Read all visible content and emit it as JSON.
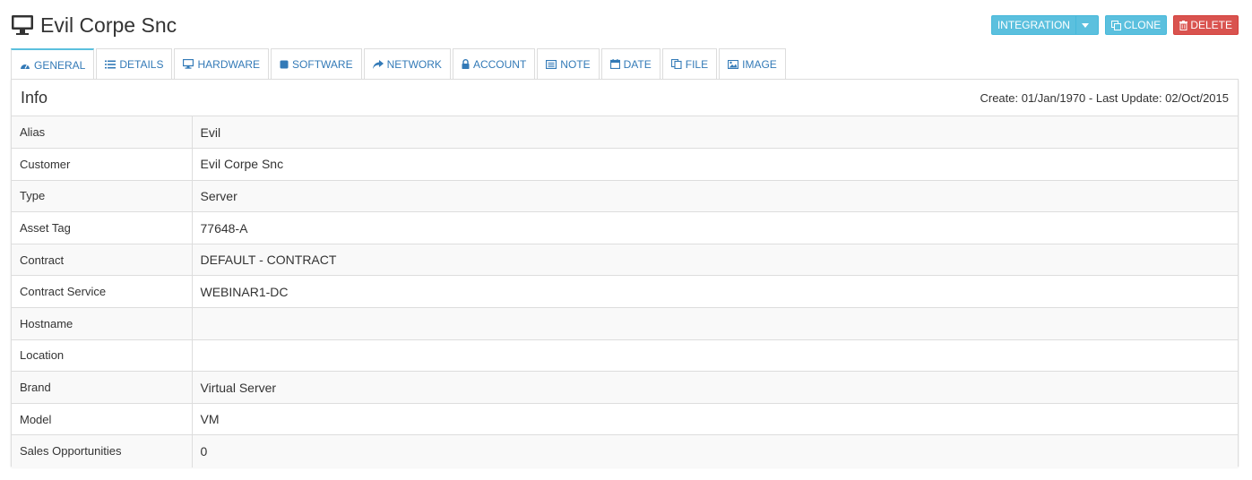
{
  "header": {
    "title": "Evil Corpe Snc",
    "icon": "monitor-icon"
  },
  "actions": {
    "integration": "INTEGRATION",
    "clone": "CLONE",
    "delete": "DELETE"
  },
  "tabs": [
    {
      "label": "GENERAL",
      "icon": "dashboard-icon"
    },
    {
      "label": "DETAILS",
      "icon": "list-icon"
    },
    {
      "label": "HARDWARE",
      "icon": "monitor-icon"
    },
    {
      "label": "SOFTWARE",
      "icon": "square-icon"
    },
    {
      "label": "NETWORK",
      "icon": "share-icon"
    },
    {
      "label": "ACCOUNT",
      "icon": "lock-icon"
    },
    {
      "label": "NOTE",
      "icon": "note-icon"
    },
    {
      "label": "DATE",
      "icon": "calendar-icon"
    },
    {
      "label": "FILE",
      "icon": "files-icon"
    },
    {
      "label": "IMAGE",
      "icon": "image-icon"
    }
  ],
  "panel": {
    "title": "Info",
    "meta": "Create: 01/Jan/1970 - Last Update: 02/Oct/2015",
    "rows": [
      {
        "label": "Alias",
        "value": "Evil"
      },
      {
        "label": "Customer",
        "value": "Evil Corpe Snc"
      },
      {
        "label": "Type",
        "value": "Server"
      },
      {
        "label": "Asset Tag",
        "value": "77648-A"
      },
      {
        "label": "Contract",
        "value": "DEFAULT - CONTRACT"
      },
      {
        "label": "Contract Service",
        "value": "WEBINAR1-DC"
      },
      {
        "label": "Hostname",
        "value": ""
      },
      {
        "label": "Location",
        "value": ""
      },
      {
        "label": "Brand",
        "value": "Virtual Server"
      },
      {
        "label": "Model",
        "value": "VM"
      },
      {
        "label": "Sales Opportunities",
        "value": "0"
      }
    ]
  },
  "colors": {
    "info": "#5bc0de",
    "danger": "#d9534f",
    "link": "#337ab7",
    "border": "#dddddd"
  }
}
